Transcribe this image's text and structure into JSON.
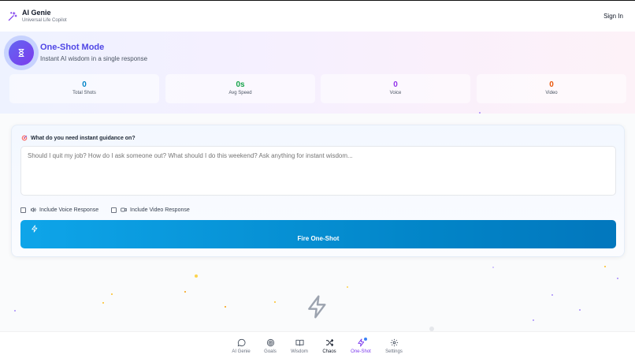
{
  "app": {
    "title": "AI Genie",
    "subtitle": "Universal Life Copilot",
    "signin_label": "Sign In"
  },
  "mode": {
    "title": "One-Shot Mode",
    "subtitle": "Instant AI wisdom in a single response",
    "badge_icon": "hourglass-icon"
  },
  "stats": [
    {
      "value": "0",
      "label": "Total Shots",
      "color": "#0284c7"
    },
    {
      "value": "0s",
      "label": "Avg Speed",
      "color": "#16a34a"
    },
    {
      "value": "0",
      "label": "Voice",
      "color": "#9333ea"
    },
    {
      "value": "0",
      "label": "Video",
      "color": "#ea580c"
    }
  ],
  "form": {
    "question_label": "What do you need instant guidance on?",
    "placeholder": "Should I quit my job? How do I ask someone out? What should I do this weekend? Ask anything for instant wisdom...",
    "value": "",
    "voice_option": "Include Voice Response",
    "video_option": "Include Video Response",
    "fire_label": "Fire One-Shot"
  },
  "nav": [
    {
      "label": "AI Genie",
      "icon": "chat-bubble-icon",
      "active": false
    },
    {
      "label": "Goals",
      "icon": "target-icon",
      "active": false
    },
    {
      "label": "Wisdom",
      "icon": "book-icon",
      "active": false
    },
    {
      "label": "Chaos",
      "icon": "shuffle-icon",
      "active": false
    },
    {
      "label": "One-Shot",
      "icon": "lightning-icon",
      "active": true
    },
    {
      "label": "Settings",
      "icon": "gear-icon",
      "active": false
    }
  ],
  "colors": {
    "accent": "#7c3aed",
    "primary_button": "#0ea5e9",
    "mode_title": "#4f46e5"
  }
}
